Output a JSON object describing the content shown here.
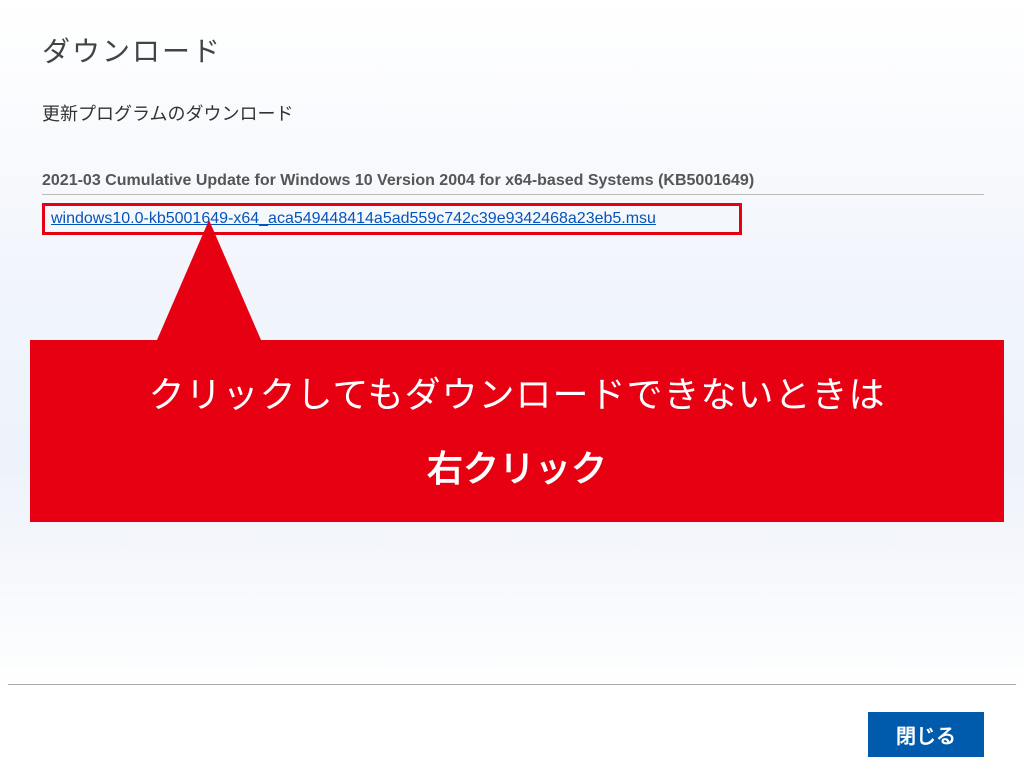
{
  "header": {
    "title": "ダウンロード",
    "subtitle": "更新プログラムのダウンロード"
  },
  "update": {
    "name": "2021-03 Cumulative Update for Windows 10 Version 2004 for x64-based Systems (KB5001649)",
    "link_text": "windows10.0-kb5001649-x64_aca549448414a5ad559c742c39e9342468a23eb5.msu"
  },
  "callout": {
    "line1": "クリックしてもダウンロードできないときは",
    "line2": "右クリック"
  },
  "footer": {
    "close_label": "閉じる"
  }
}
